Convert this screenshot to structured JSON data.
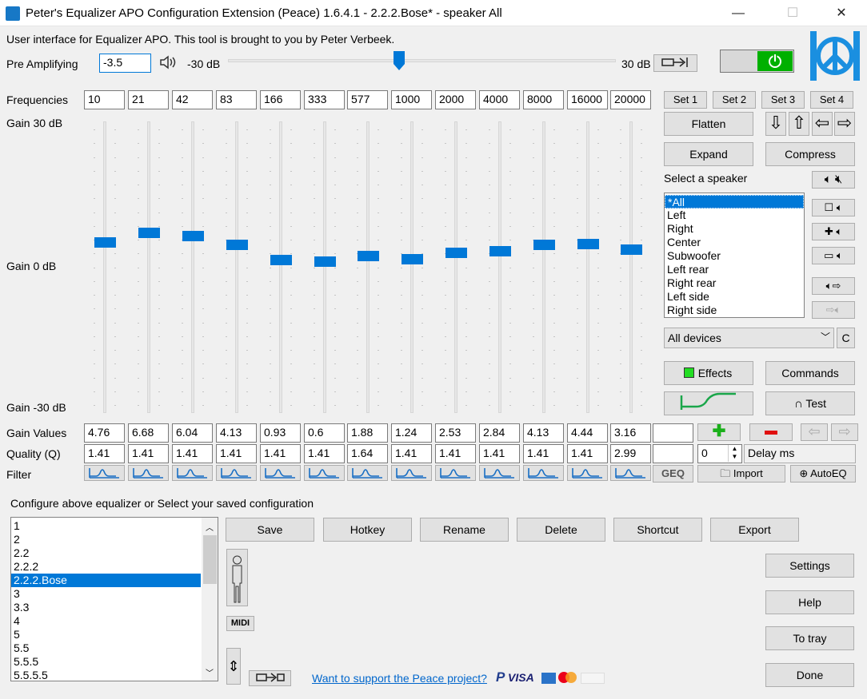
{
  "window": {
    "title": "Peter's Equalizer APO Configuration Extension (Peace) 1.6.4.1 - 2.2.2.Bose* - speaker All",
    "minimize": "—",
    "maximize": "☐",
    "close": "✕"
  },
  "intro": "User interface for Equalizer APO. This tool is brought to you by Peter Verbeek.",
  "preamp": {
    "label": "Pre Amplifying",
    "value": "-3.5",
    "min_label": "-30 dB",
    "max_label": "30 dB",
    "level_db": -3.5
  },
  "labels": {
    "frequencies": "Frequencies",
    "gain_top": "Gain 30 dB",
    "gain_mid": "Gain 0 dB",
    "gain_bottom": "Gain -30 dB",
    "gain_values": "Gain Values",
    "quality": "Quality (Q)",
    "filter": "Filter"
  },
  "frequencies": [
    "10",
    "21",
    "42",
    "83",
    "166",
    "333",
    "577",
    "1000",
    "2000",
    "4000",
    "8000",
    "16000",
    "20000"
  ],
  "gains": [
    "4.76",
    "6.68",
    "6.04",
    "4.13",
    "0.93",
    "0.6",
    "1.88",
    "1.24",
    "2.53",
    "2.84",
    "4.13",
    "4.44",
    "3.16"
  ],
  "gain_numbers": [
    4.76,
    6.68,
    6.04,
    4.13,
    0.93,
    0.6,
    1.88,
    1.24,
    2.53,
    2.84,
    4.13,
    4.44,
    3.16
  ],
  "qualities": [
    "1.41",
    "1.41",
    "1.41",
    "1.41",
    "1.41",
    "1.41",
    "1.64",
    "1.41",
    "1.41",
    "1.41",
    "1.41",
    "1.41",
    "2.99"
  ],
  "sets": [
    "Set 1",
    "Set 2",
    "Set 3",
    "Set 4"
  ],
  "buttons": {
    "flatten": "Flatten",
    "expand": "Expand",
    "compress": "Compress",
    "effects": "Effects",
    "commands": "Commands",
    "test": "Test",
    "import": "Import",
    "autoeq": "AutoEQ",
    "geq": "GEQ",
    "c": "C",
    "delay": "Delay ms",
    "delay_value": "0",
    "midi": "MIDI"
  },
  "speaker": {
    "label": "Select a speaker",
    "items": [
      "*All",
      "Left",
      "Right",
      "Center",
      "Subwoofer",
      "Left rear",
      "Right rear",
      "Left side",
      "Right side"
    ],
    "selected": 0,
    "device": "All devices"
  },
  "config": {
    "label": "Configure above equalizer or Select your saved configuration",
    "items": [
      "1",
      "2",
      "2.2",
      "2.2.2",
      "2.2.2.Bose",
      "3",
      "3.3",
      "4",
      "5",
      "5.5",
      "5.5.5",
      "5.5.5.5"
    ],
    "selected": 4
  },
  "actions": [
    "Save",
    "Hotkey",
    "Rename",
    "Delete",
    "Shortcut",
    "Export"
  ],
  "side": [
    "Settings",
    "Help",
    "To tray",
    "Done"
  ],
  "support": "Want to support the Peace project?",
  "payments": {
    "paypal": "P",
    "visa": "VISA"
  },
  "colors": {
    "accent": "#0078d7",
    "power": "#00b000",
    "logo": "#1a8fe0"
  }
}
